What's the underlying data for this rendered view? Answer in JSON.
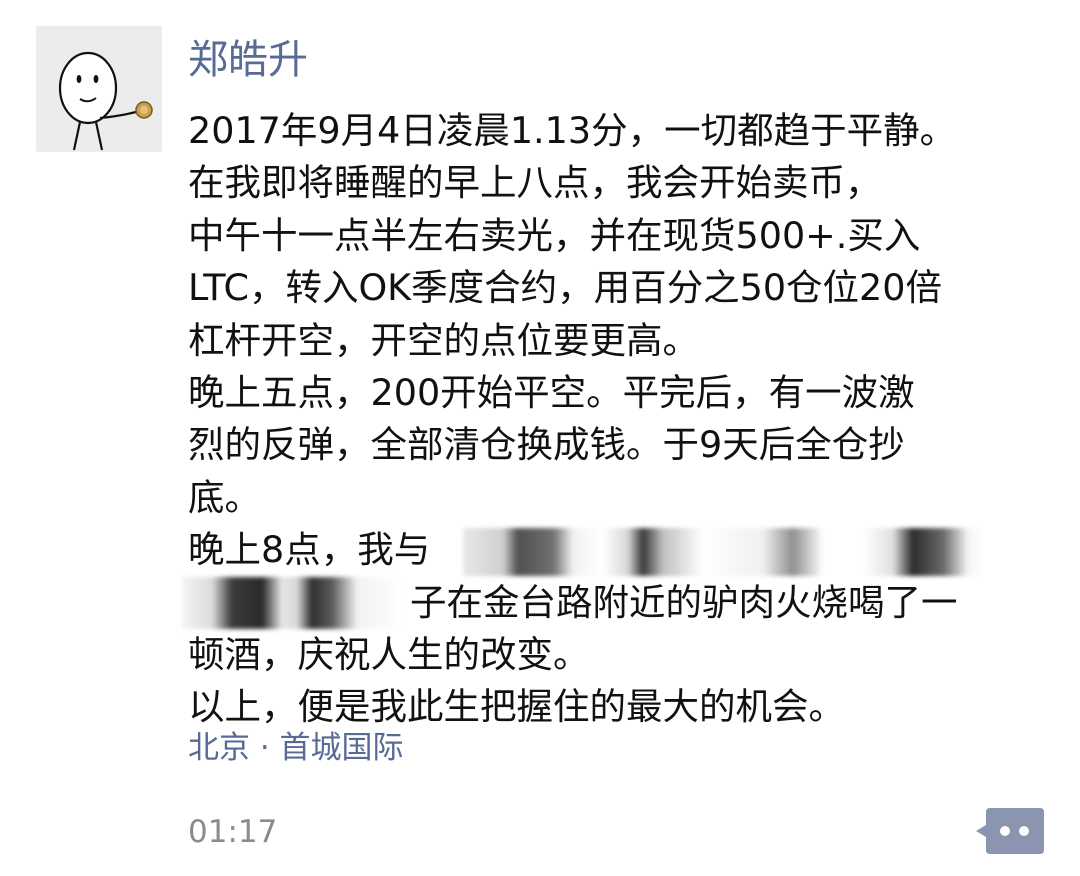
{
  "post": {
    "author": "郑皓升",
    "lines": [
      "2017年9月4日凌晨1.13分，一切都趋于平静。",
      "在我即将睡醒的早上八点，我会开始卖币，",
      "中午十一点半左右卖光，并在现货500+.买入",
      "LTC，转入OK季度合约，用百分之50仓位20倍",
      "杠杆开空，开空的点位要更高。",
      "晚上五点，200开始平空。平完后，有一波激",
      "烈的反弹，全部清仓换成钱。于9天后全仓抄",
      "底。",
      "晚上8点，我与",
      "子在金台路附近的驴肉火烧喝了一",
      "顿酒，庆祝人生的改变。",
      "以上，便是我此生把握住的最大的机会。"
    ],
    "location": "北京 · 首城国际",
    "time": "01:17"
  },
  "icons": {
    "avatar": "cartoon-avatar-icon",
    "more": "more-dots-icon"
  },
  "colors": {
    "author_link": "#576b95",
    "timestamp": "#8b8b8b",
    "more_button_bg": "#8a95b0"
  }
}
